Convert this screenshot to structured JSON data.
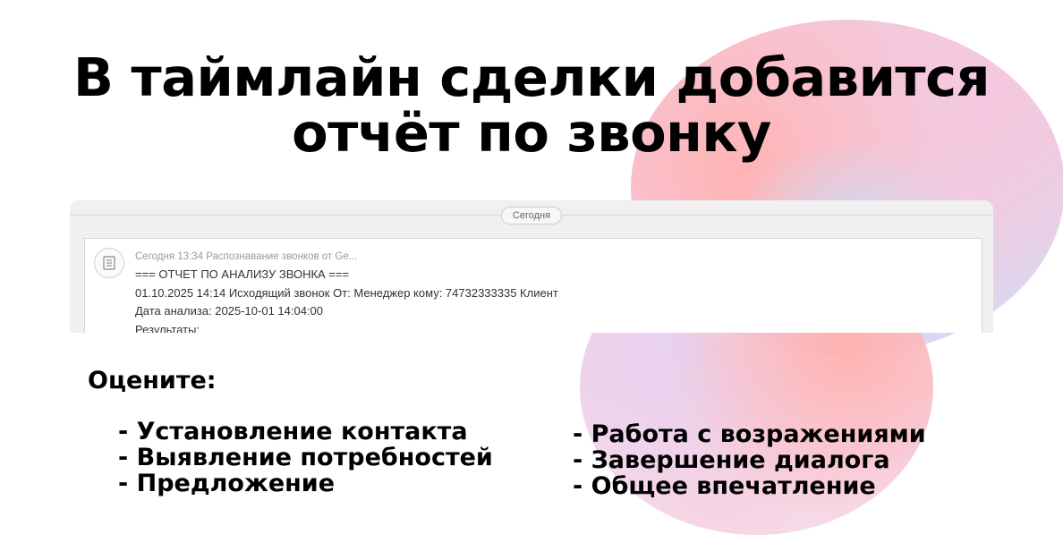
{
  "slide": {
    "title_line1": "В таймлайн сделки добавится",
    "title_line2": "отчёт по звонку"
  },
  "timeline": {
    "day_label": "Сегодня",
    "note": {
      "icon": "document-icon",
      "meta": "Сегодня 13:34 Распознавание звонков от Ge...",
      "lines": [
        "=== ОТЧЕТ ПО АНАЛИЗУ ЗВОНКА ===",
        "01.10.2025 14:14 Исходящий звонок От: Менеджер кому: 74732333335 Клиент",
        "Дата анализа: 2025-10-01 14:04:00",
        "Результаты:"
      ]
    }
  },
  "criteria": {
    "heading": "Оцените:",
    "left": [
      "- Установление контакта",
      "- Выявление потребностей",
      "- Предложение"
    ],
    "right": [
      "- Работа с возражениями",
      "- Завершение диалога",
      "- Общее впечатление"
    ]
  },
  "colors": {
    "blob_pink": "#f7c2d2",
    "blob_coral": "#ffb0ae",
    "blob_blue": "#c9defa",
    "timeline_bg": "#f0f0f0"
  }
}
